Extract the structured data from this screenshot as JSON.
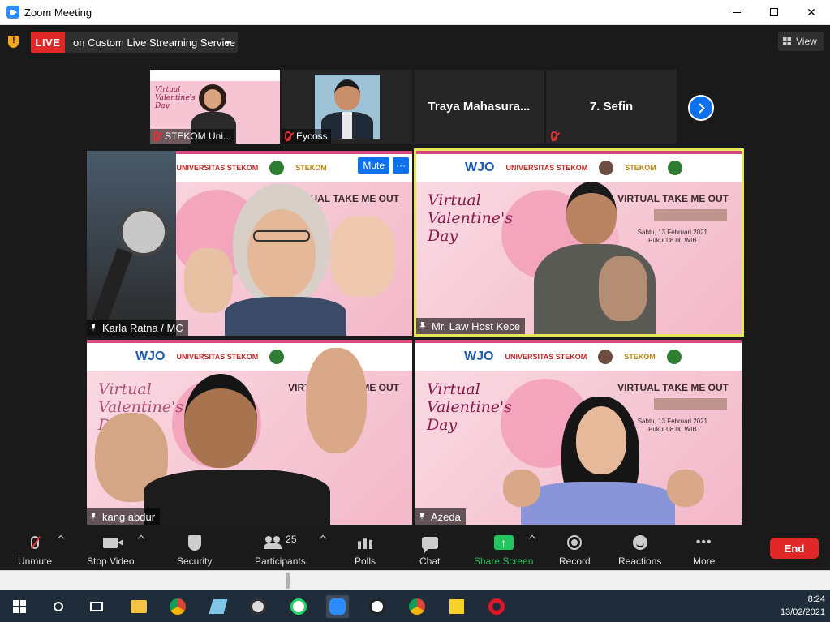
{
  "window": {
    "title": "Zoom Meeting",
    "minimize": "",
    "maximize": "",
    "close": "✕"
  },
  "topbar": {
    "live_label": "LIVE",
    "stream_label": "on Custom Live Streaming Service",
    "view_label": "View"
  },
  "thumbnails": [
    {
      "name": "STEKOM Uni..."
    },
    {
      "name": "Eycoss"
    },
    {
      "name": "Traya  Mahasura..."
    },
    {
      "name": "7. Sefin"
    }
  ],
  "slide": {
    "wjo": "WJO",
    "stekom_univ": "UNIVERSITAS STEKOM",
    "stekom": "STEKOM",
    "valentine": "Virtual Valentine's Day",
    "take_me_out": "VIRTUAL TAKE ME OUT",
    "event_date": "Sabtu, 13 Februari 2021",
    "event_time": "Pukul 08.00 WIB"
  },
  "tiles": [
    {
      "name": "Karla Ratna / MC",
      "mute_label": "Mute",
      "more_label": "···"
    },
    {
      "name": "Mr. Law Host Kece"
    },
    {
      "name": "kang abdur"
    },
    {
      "name": "Azeda"
    }
  ],
  "toolbar": {
    "unmute": "Unmute",
    "stop_video": "Stop Video",
    "security": "Security",
    "participants": "Participants",
    "participants_count": "25",
    "polls": "Polls",
    "chat": "Chat",
    "share_screen": "Share Screen",
    "record": "Record",
    "reactions": "Reactions",
    "more": "More",
    "end": "End",
    "colors": {
      "share": "#23c55e",
      "end": "#e02828",
      "live": "#e02828"
    }
  },
  "taskbar": {
    "time": "8:24",
    "date": "13/02/2021"
  }
}
